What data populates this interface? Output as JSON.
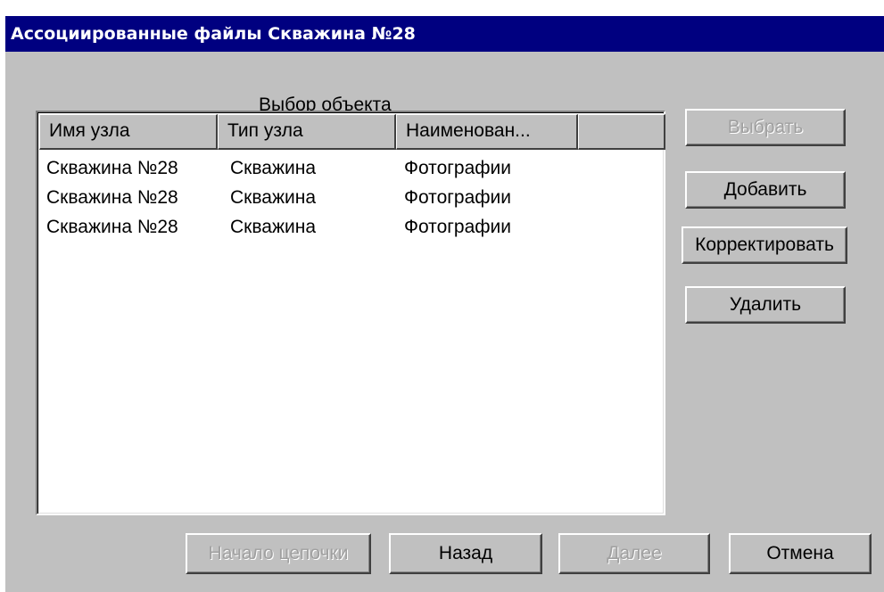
{
  "window": {
    "title": "Ассоциированные файлы  Скважина №28"
  },
  "section_label": "Выбор  объекта",
  "list": {
    "columns": [
      "Имя узла",
      "Тип узла",
      "Наименован...",
      ""
    ],
    "rows": [
      [
        "Скважина №28",
        "Скважина",
        "Фотографии"
      ],
      [
        "Скважина №28",
        "Скважина",
        "Фотографии"
      ],
      [
        "Скважина №28",
        "Скважина",
        "Фотографии"
      ]
    ]
  },
  "side_buttons": {
    "select": "Выбрать",
    "add": "Добавить",
    "edit": "Корректировать",
    "delete": "Удалить"
  },
  "bottom_buttons": {
    "chain_start": "Начало цепочки",
    "back": "Назад",
    "next": "Далее",
    "cancel": "Отмена"
  },
  "colors": {
    "titlebar": "#000080",
    "face": "#c0c0c0",
    "disabled_text": "#a0a0a0"
  }
}
